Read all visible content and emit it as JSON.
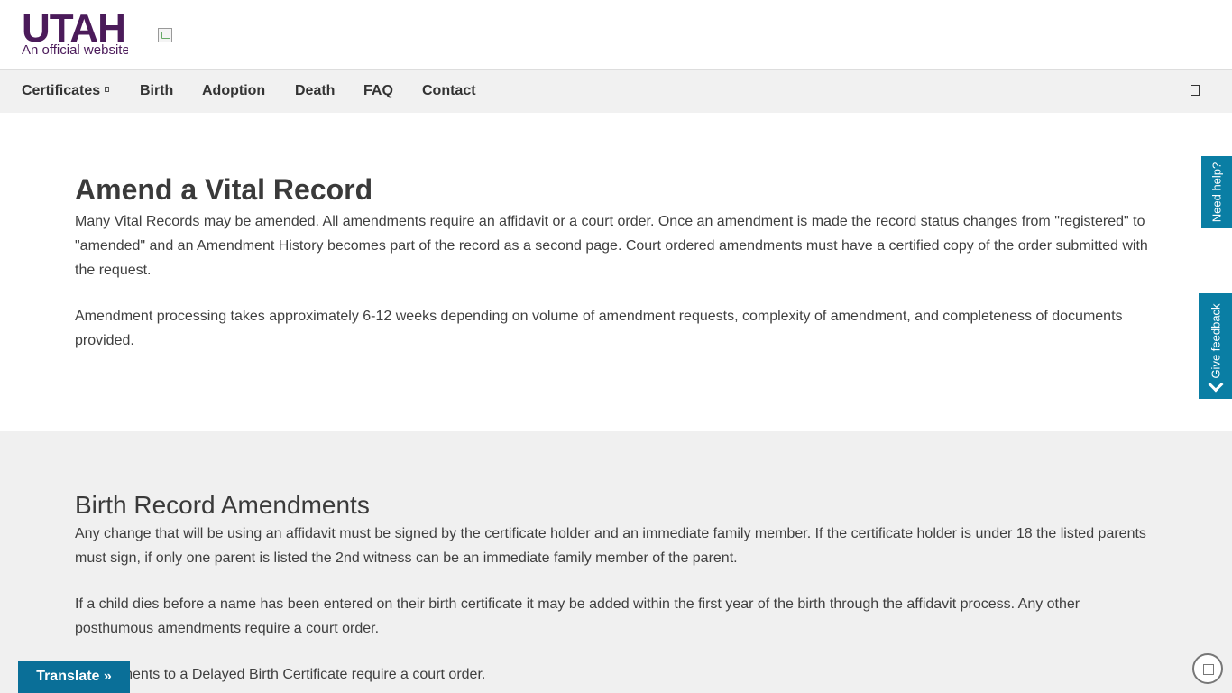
{
  "header": {
    "logo_main": "UTAH",
    "logo_sub": "An official website"
  },
  "nav": {
    "items": [
      {
        "label": "Certificates"
      },
      {
        "label": "Birth"
      },
      {
        "label": "Adoption"
      },
      {
        "label": "Death"
      },
      {
        "label": "FAQ"
      },
      {
        "label": "Contact"
      }
    ],
    "search_icon": "search-icon",
    "caret_icon": "chevron-down-icon"
  },
  "main": {
    "title": "Amend a Vital Record",
    "paragraphs": [
      "Many Vital Records may be amended. All amendments require an affidavit or a court order. Once an amendment is made the record status changes from \"registered\" to \"amended\" and an Amendment History becomes part of the record as a second page. Court ordered amendments must have a certified copy of the order submitted with the request.",
      "Amendment processing takes approximately 6-12 weeks depending on volume of amendment requests, complexity of amendment, and completeness of documents provided."
    ]
  },
  "birth_section": {
    "title": "Birth Record Amendments",
    "paragraphs": [
      "Any change that will be using an affidavit must be signed by the certificate holder and an immediate family member. If the certificate holder is under 18 the listed parents must sign, if only one parent is listed the 2nd witness can be an immediate family member of the parent.",
      "If a child dies before a name has been entered on their birth certificate it may be added within the first year of the birth through the affidavit process. Any other posthumous amendments require a court order.",
      "Amendments to a Delayed Birth Certificate require a court order."
    ]
  },
  "side_tabs": {
    "help": "Need help?",
    "feedback": "Give feedback"
  },
  "translate": {
    "label": "Translate »"
  },
  "colors": {
    "brand_purple": "#4b1b5a",
    "accent_teal": "#0a7ea4"
  }
}
